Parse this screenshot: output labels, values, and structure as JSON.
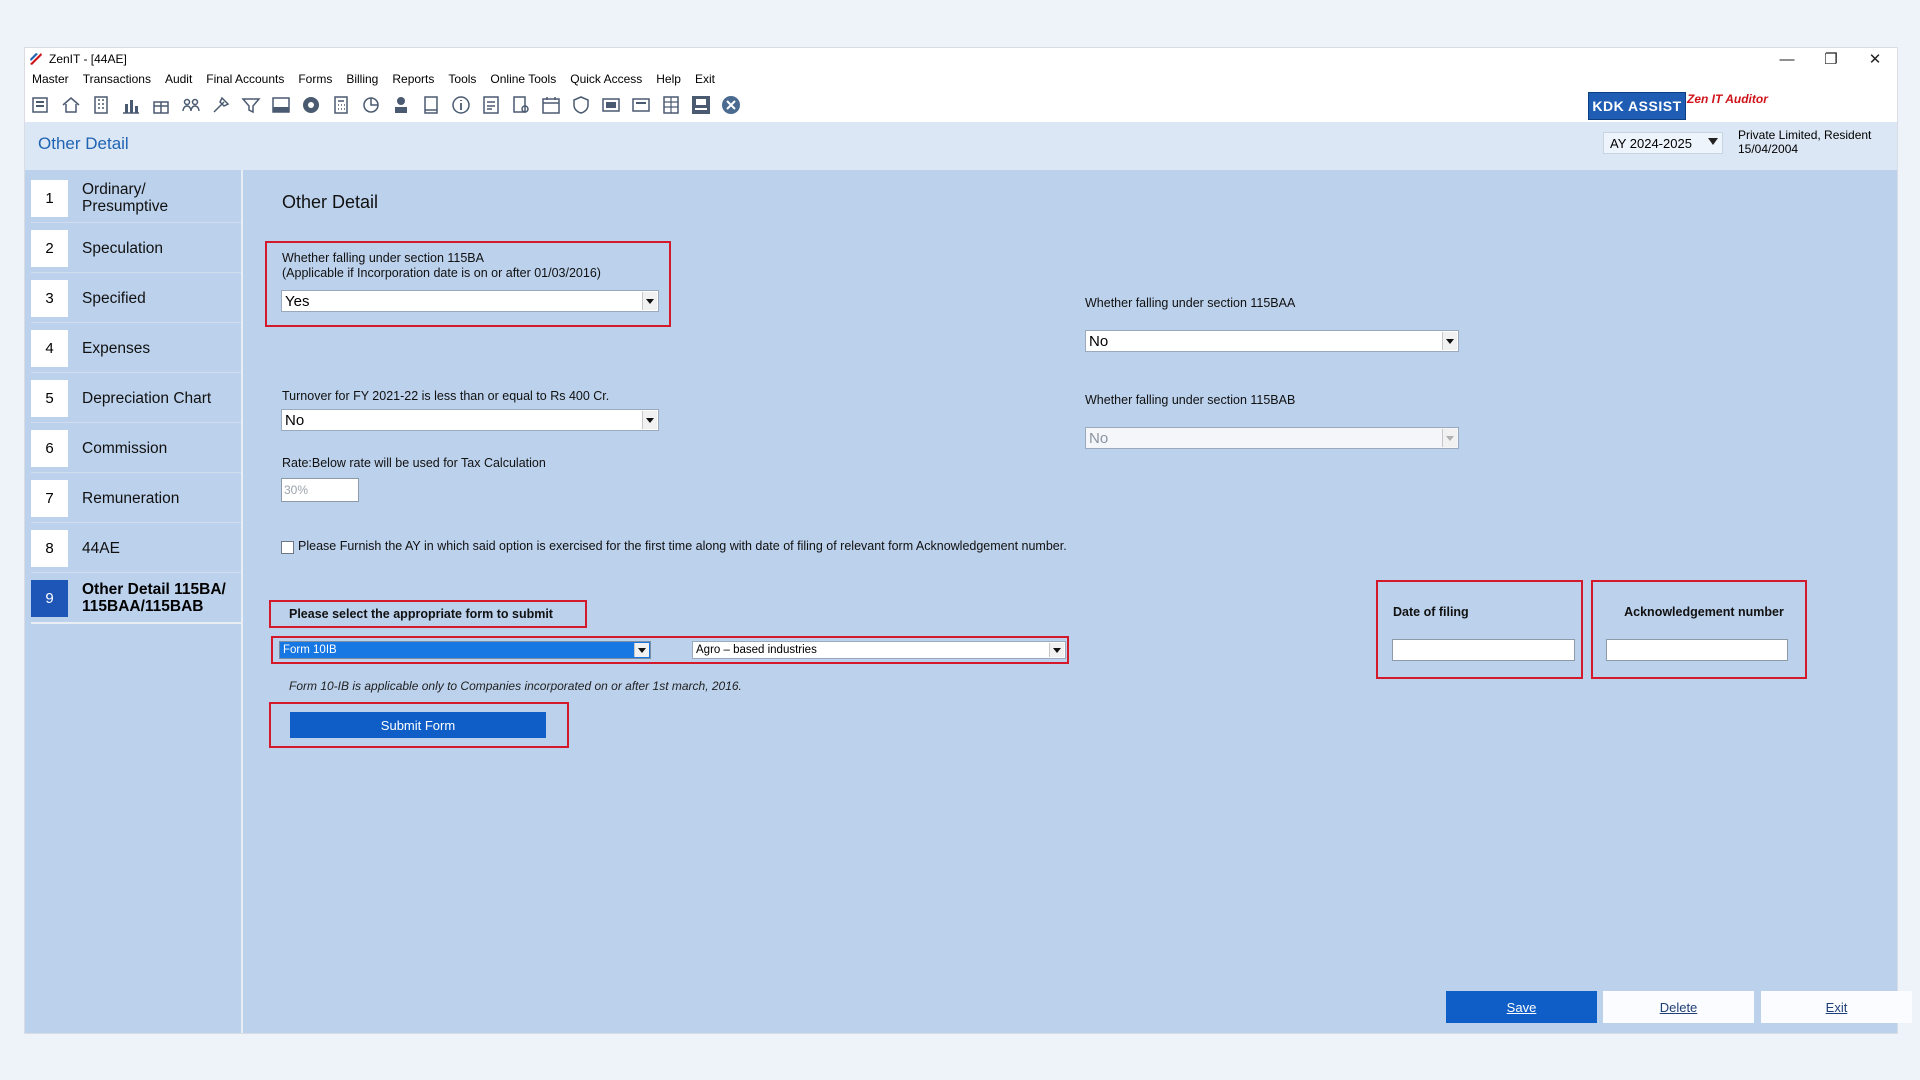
{
  "window": {
    "title": "ZenIT - [44AE]",
    "minimize": "—",
    "restore": "❐",
    "close": "✕"
  },
  "menu": [
    "Master",
    "Transactions",
    "Audit",
    "Final Accounts",
    "Forms",
    "Billing",
    "Reports",
    "Tools",
    "Online Tools",
    "Quick Access",
    "Help",
    "Exit"
  ],
  "toolbar": {
    "icons": [
      "open-icon",
      "home-icon",
      "building-icon",
      "bar-chart-icon",
      "gift-icon",
      "people-icon",
      "tools-icon",
      "filter-icon",
      "tax-icon",
      "eye-icon",
      "calculator-icon",
      "pie-chart-icon",
      "payment-icon",
      "book-icon",
      "info-icon",
      "report-icon",
      "search-doc-icon",
      "calendar-icon",
      "shield-icon",
      "bs-icon",
      "3cd-icon",
      "grid-icon",
      "fac-icon",
      "close-circle-icon"
    ],
    "kdk_label": "KDK ASSIST",
    "zen_label": "Zen IT Auditor"
  },
  "header": {
    "page_title": "Other Detail",
    "ay": "AY 2024-2025",
    "entity_type": "Private Limited, Resident",
    "entity_date": "15/04/2004"
  },
  "sidebar": [
    {
      "num": "1",
      "label": "Ordinary/ Presumptive"
    },
    {
      "num": "2",
      "label": "Speculation"
    },
    {
      "num": "3",
      "label": "Specified"
    },
    {
      "num": "4",
      "label": "Expenses"
    },
    {
      "num": "5",
      "label": "Depreciation Chart"
    },
    {
      "num": "6",
      "label": "Commission"
    },
    {
      "num": "7",
      "label": "Remuneration"
    },
    {
      "num": "8",
      "label": "44AE"
    },
    {
      "num": "9",
      "label": "Other Detail 115BA/ 115BAA/115BAB"
    }
  ],
  "form": {
    "section_title": "Other Detail",
    "q115ba_line1": "Whether falling under section 115BA",
    "q115ba_line2": "(Applicable if Incorporation date is on or after 01/03/2016)",
    "q115ba_value": "Yes",
    "turnover_label": "Turnover for FY 2021-22 is less than or equal to Rs 400 Cr.",
    "turnover_value": "No",
    "rate_label": "Rate:Below rate will be used for Tax Calculation",
    "rate_value": "30%",
    "q115baa_label": "Whether falling under section 115BAA",
    "q115baa_value": "No",
    "q115bab_label": "Whether falling under section 115BAB",
    "q115bab_value": "No",
    "furnish_label": "Please Furnish the AY in which said option is exercised for the first time along with date of filing of relevant form  Acknowledgement number.",
    "select_form_label": "Please select the appropriate form to submit",
    "form_value": "Form 10IB",
    "industry_value": "Agro – based industries",
    "form_note": "Form 10-IB is applicable only to Companies incorporated on or after 1st march, 2016.",
    "submit_label": "Submit Form",
    "date_of_filing_label": "Date of filing",
    "ack_label": "Acknowledgement number"
  },
  "footer": {
    "save": "Save",
    "delete": "Delete",
    "exit": "Exit"
  },
  "colors": {
    "accent": "#1e56b8",
    "highlight_red": "#d41a2a",
    "panel": "#bcd1ec"
  }
}
